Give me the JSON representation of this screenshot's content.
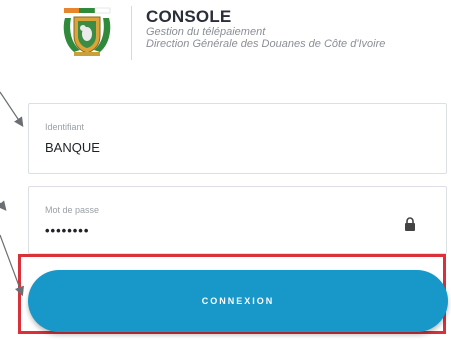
{
  "header": {
    "title": "CONSOLE",
    "subtitle_line1": "Gestion du télépaiement",
    "subtitle_line2": "Direction Générale des Douanes de Côte d'Ivoire"
  },
  "form": {
    "identifier": {
      "label": "Identifiant",
      "value": "BANQUE"
    },
    "password": {
      "label": "Mot de passe",
      "value": "••••••••"
    },
    "submit_label": "CONNEXION"
  },
  "colors": {
    "button": "#1798c8",
    "highlight_box": "#d9303a",
    "logo_orange": "#e8852a",
    "logo_green": "#2f8a3c"
  },
  "icons": [
    "coat-of-arms-logo",
    "lock-icon",
    "annotation-arrow"
  ]
}
